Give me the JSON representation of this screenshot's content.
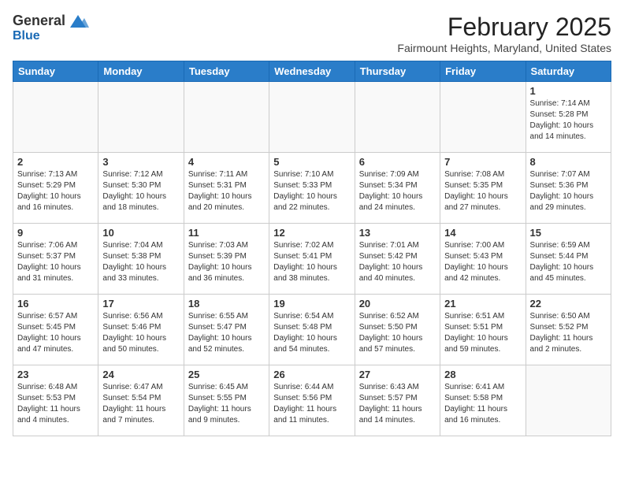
{
  "header": {
    "logo_general": "General",
    "logo_blue": "Blue",
    "title": "February 2025",
    "location": "Fairmount Heights, Maryland, United States"
  },
  "weekdays": [
    "Sunday",
    "Monday",
    "Tuesday",
    "Wednesday",
    "Thursday",
    "Friday",
    "Saturday"
  ],
  "weeks": [
    [
      {
        "empty": true
      },
      {
        "empty": true
      },
      {
        "empty": true
      },
      {
        "empty": true
      },
      {
        "empty": true
      },
      {
        "empty": true
      },
      {
        "day": 1,
        "sunrise": "7:14 AM",
        "sunset": "5:28 PM",
        "daylight": "10 hours and 14 minutes."
      }
    ],
    [
      {
        "day": 2,
        "sunrise": "7:13 AM",
        "sunset": "5:29 PM",
        "daylight": "10 hours and 16 minutes."
      },
      {
        "day": 3,
        "sunrise": "7:12 AM",
        "sunset": "5:30 PM",
        "daylight": "10 hours and 18 minutes."
      },
      {
        "day": 4,
        "sunrise": "7:11 AM",
        "sunset": "5:31 PM",
        "daylight": "10 hours and 20 minutes."
      },
      {
        "day": 5,
        "sunrise": "7:10 AM",
        "sunset": "5:33 PM",
        "daylight": "10 hours and 22 minutes."
      },
      {
        "day": 6,
        "sunrise": "7:09 AM",
        "sunset": "5:34 PM",
        "daylight": "10 hours and 24 minutes."
      },
      {
        "day": 7,
        "sunrise": "7:08 AM",
        "sunset": "5:35 PM",
        "daylight": "10 hours and 27 minutes."
      },
      {
        "day": 8,
        "sunrise": "7:07 AM",
        "sunset": "5:36 PM",
        "daylight": "10 hours and 29 minutes."
      }
    ],
    [
      {
        "day": 9,
        "sunrise": "7:06 AM",
        "sunset": "5:37 PM",
        "daylight": "10 hours and 31 minutes."
      },
      {
        "day": 10,
        "sunrise": "7:04 AM",
        "sunset": "5:38 PM",
        "daylight": "10 hours and 33 minutes."
      },
      {
        "day": 11,
        "sunrise": "7:03 AM",
        "sunset": "5:39 PM",
        "daylight": "10 hours and 36 minutes."
      },
      {
        "day": 12,
        "sunrise": "7:02 AM",
        "sunset": "5:41 PM",
        "daylight": "10 hours and 38 minutes."
      },
      {
        "day": 13,
        "sunrise": "7:01 AM",
        "sunset": "5:42 PM",
        "daylight": "10 hours and 40 minutes."
      },
      {
        "day": 14,
        "sunrise": "7:00 AM",
        "sunset": "5:43 PM",
        "daylight": "10 hours and 42 minutes."
      },
      {
        "day": 15,
        "sunrise": "6:59 AM",
        "sunset": "5:44 PM",
        "daylight": "10 hours and 45 minutes."
      }
    ],
    [
      {
        "day": 16,
        "sunrise": "6:57 AM",
        "sunset": "5:45 PM",
        "daylight": "10 hours and 47 minutes."
      },
      {
        "day": 17,
        "sunrise": "6:56 AM",
        "sunset": "5:46 PM",
        "daylight": "10 hours and 50 minutes."
      },
      {
        "day": 18,
        "sunrise": "6:55 AM",
        "sunset": "5:47 PM",
        "daylight": "10 hours and 52 minutes."
      },
      {
        "day": 19,
        "sunrise": "6:54 AM",
        "sunset": "5:48 PM",
        "daylight": "10 hours and 54 minutes."
      },
      {
        "day": 20,
        "sunrise": "6:52 AM",
        "sunset": "5:50 PM",
        "daylight": "10 hours and 57 minutes."
      },
      {
        "day": 21,
        "sunrise": "6:51 AM",
        "sunset": "5:51 PM",
        "daylight": "10 hours and 59 minutes."
      },
      {
        "day": 22,
        "sunrise": "6:50 AM",
        "sunset": "5:52 PM",
        "daylight": "11 hours and 2 minutes."
      }
    ],
    [
      {
        "day": 23,
        "sunrise": "6:48 AM",
        "sunset": "5:53 PM",
        "daylight": "11 hours and 4 minutes."
      },
      {
        "day": 24,
        "sunrise": "6:47 AM",
        "sunset": "5:54 PM",
        "daylight": "11 hours and 7 minutes."
      },
      {
        "day": 25,
        "sunrise": "6:45 AM",
        "sunset": "5:55 PM",
        "daylight": "11 hours and 9 minutes."
      },
      {
        "day": 26,
        "sunrise": "6:44 AM",
        "sunset": "5:56 PM",
        "daylight": "11 hours and 11 minutes."
      },
      {
        "day": 27,
        "sunrise": "6:43 AM",
        "sunset": "5:57 PM",
        "daylight": "11 hours and 14 minutes."
      },
      {
        "day": 28,
        "sunrise": "6:41 AM",
        "sunset": "5:58 PM",
        "daylight": "11 hours and 16 minutes."
      },
      {
        "empty": true
      }
    ]
  ]
}
